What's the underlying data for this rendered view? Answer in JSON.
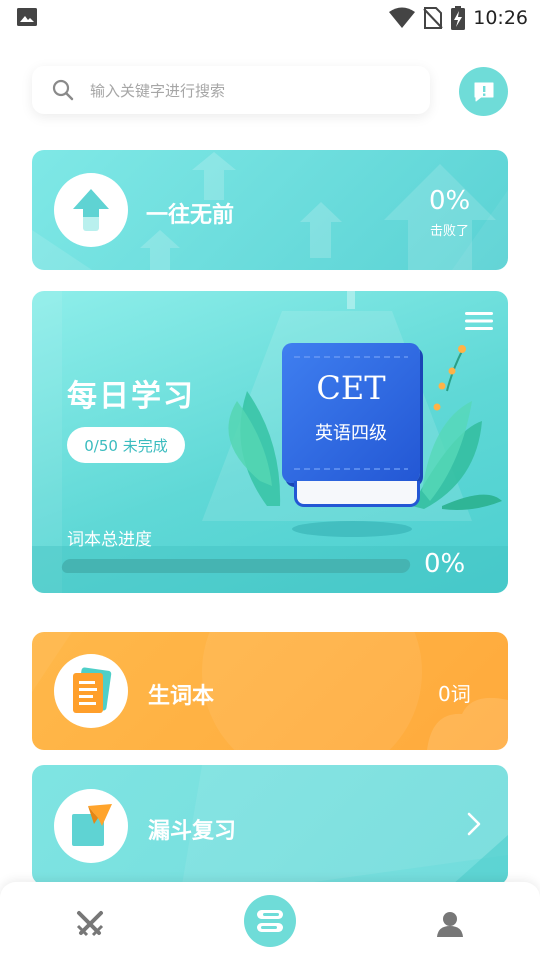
{
  "statusbar": {
    "time": "10:26"
  },
  "search": {
    "placeholder": "输入关键字进行搜索"
  },
  "rank_card": {
    "title": "一往无前",
    "percent": "0%",
    "beaten_label": "击败了"
  },
  "daily_card": {
    "title": "每日学习",
    "status": "0/50 未完成",
    "book_title": "CET",
    "book_subtitle": "英语四级",
    "progress_label": "词本总进度",
    "progress_percent": "0%",
    "progress_value": 0
  },
  "vocab_card": {
    "title": "生词本",
    "count": "0词"
  },
  "funnel_card": {
    "title": "漏斗复习"
  },
  "colors": {
    "teal": "#6fdcd8",
    "orange": "#ffb047",
    "book_blue": "#2c62dd"
  },
  "bottom_nav": {
    "icons": [
      "swords-icon",
      "book-stack-icon",
      "profile-icon"
    ]
  }
}
